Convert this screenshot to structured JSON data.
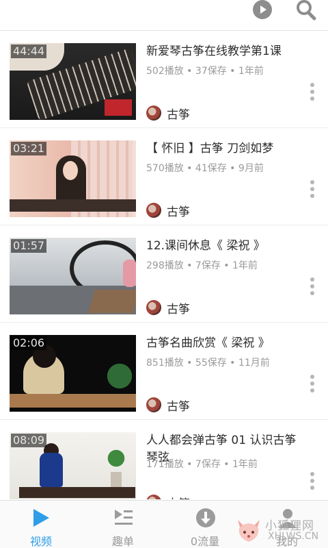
{
  "header": {
    "play_icon": "play-circle-icon",
    "search_icon": "search-icon"
  },
  "videos": [
    {
      "duration": "44:44",
      "title": "新爱琴古筝在线教学第1课",
      "plays": "502播放",
      "saves": "37保存",
      "age": "1年前",
      "author": "古筝"
    },
    {
      "duration": "03:21",
      "title": "【 怀旧 】古筝 刀剑如梦",
      "plays": "570播放",
      "saves": "41保存",
      "age": "9月前",
      "author": "古筝"
    },
    {
      "duration": "01:57",
      "title": "12.课间休息《 梁祝 》",
      "plays": "298播放",
      "saves": "7保存",
      "age": "1年前",
      "author": "古筝"
    },
    {
      "duration": "02:06",
      "title": "古筝名曲欣赏《 梁祝 》",
      "plays": "851播放",
      "saves": "55保存",
      "age": "11月前",
      "author": "古筝"
    },
    {
      "duration": "08:09",
      "title": "人人都会弹古筝 01 认识古筝琴弦",
      "plays": "171播放",
      "saves": "7保存",
      "age": "1年前",
      "author": "古筝"
    }
  ],
  "meta_separator": " • ",
  "bottom_nav": {
    "tabs": [
      {
        "label": "视频",
        "icon": "play-triangle-icon",
        "active": true
      },
      {
        "label": "趣单",
        "icon": "playlist-icon",
        "active": false
      },
      {
        "label": "0流量",
        "icon": "download-icon",
        "active": false
      },
      {
        "label": "我的",
        "icon": "person-icon",
        "active": false
      }
    ]
  },
  "watermark": {
    "text": "小狐狸网",
    "sub": "XHLWS.CN"
  },
  "colors": {
    "accent": "#2f9ee8",
    "icon_gray": "#9b9b9b",
    "meta_gray": "#9a9a9a"
  }
}
